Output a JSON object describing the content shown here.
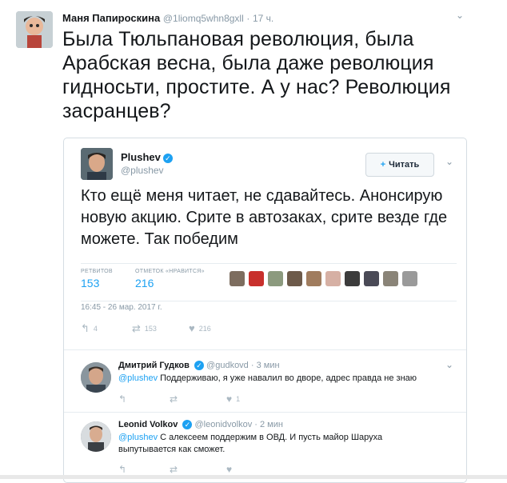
{
  "outer_tweet": {
    "name": "Маня Папироскина",
    "handle": "@1liomq5whn8gxll",
    "separator": "·",
    "time": "17 ч.",
    "text": "Была Тюльпановая революция, была Арабская весна, была даже революция гидносьти, простите. А у нас? Революция засранцев?"
  },
  "quoted_tweet": {
    "name": "Plushev",
    "verified_icon": "✓",
    "handle": "@plushev",
    "follow_label": "Читать",
    "follow_icon": "+",
    "text": "Кто ещё меня читает, не сдавайтесь. Анонсирую новую акцию. Срите в автозаках, срите везде где можете. Так победим",
    "retweets_label": "РЕТВИТОВ",
    "retweets_count": "153",
    "likes_label": "ОТМЕТОК «НРАВИТСЯ»",
    "likes_count": "216",
    "timestamp": "16:45 - 26 мар. 2017 г.",
    "reply_count": "4",
    "retweet_count_small": "153",
    "like_count_small": "216",
    "liker_colors": [
      "#7d6d5f",
      "#c8302c",
      "#8c9a7e",
      "#6d5a4a",
      "#a07c5e",
      "#d6b0a4",
      "#3c3c3c",
      "#4a4a56",
      "#8a8478",
      "#9a9a9a"
    ]
  },
  "replies": [
    {
      "name": "Дмитрий Гудков",
      "handle": "@gudkovd",
      "separator": "·",
      "time": "3 мин",
      "mention": "@plushev",
      "text": " Поддерживаю, я уже навалил во дворе, адрес правда не знаю",
      "like_count": "1"
    },
    {
      "name": "Leonid Volkov",
      "handle": "@leonidvolkov",
      "separator": "·",
      "time": "2 мин",
      "mention": "@plushev",
      "text": " С алексеем поддержим в ОВД. И пусть майор Шаруха выпутывается как сможет."
    }
  ],
  "icons": {
    "chevron": "⌄",
    "reply": "↰",
    "retweet": "⇄",
    "like": "♥"
  },
  "colors": {
    "accent": "#1da1f2",
    "muted": "#8899a6",
    "text": "#14171a"
  }
}
